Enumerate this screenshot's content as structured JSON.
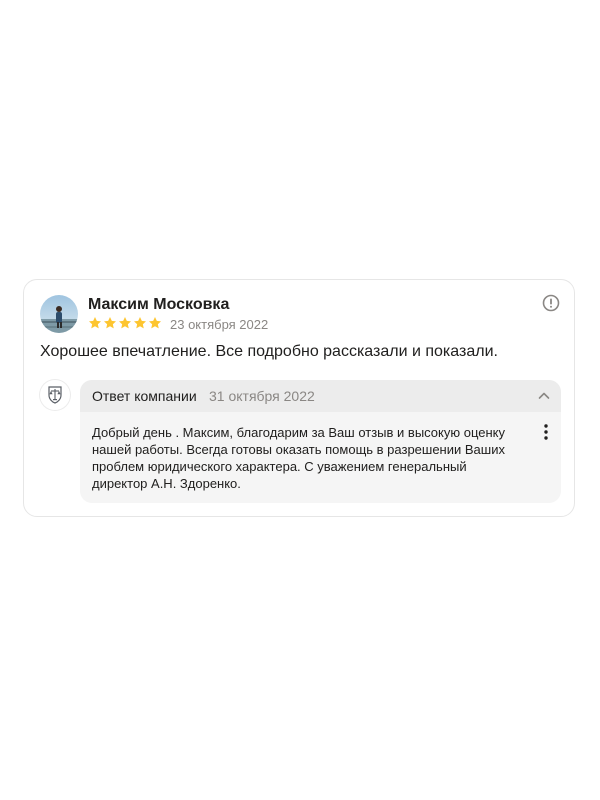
{
  "review": {
    "author_name": "Максим Московка",
    "rating": 5,
    "max_rating": 5,
    "date": "23 октября 2022",
    "text": "Хорошее впечатление. Все подробно рассказали и показали.",
    "star_color": "#fdc530"
  },
  "reply": {
    "title": "Ответ компании",
    "date": "31 октября 2022",
    "text": "Добрый день . Максим, благодарим за Ваш отзыв и высокую оценку нашей работы. Всегда готовы оказать помощь в разрешении Ваших проблем юридического характера. С уважением генеральный директор А.Н. Здоренко."
  },
  "icons": {
    "report": "exclamation-circle-icon",
    "collapse": "chevron-up-icon",
    "more": "vertical-dots-icon"
  }
}
